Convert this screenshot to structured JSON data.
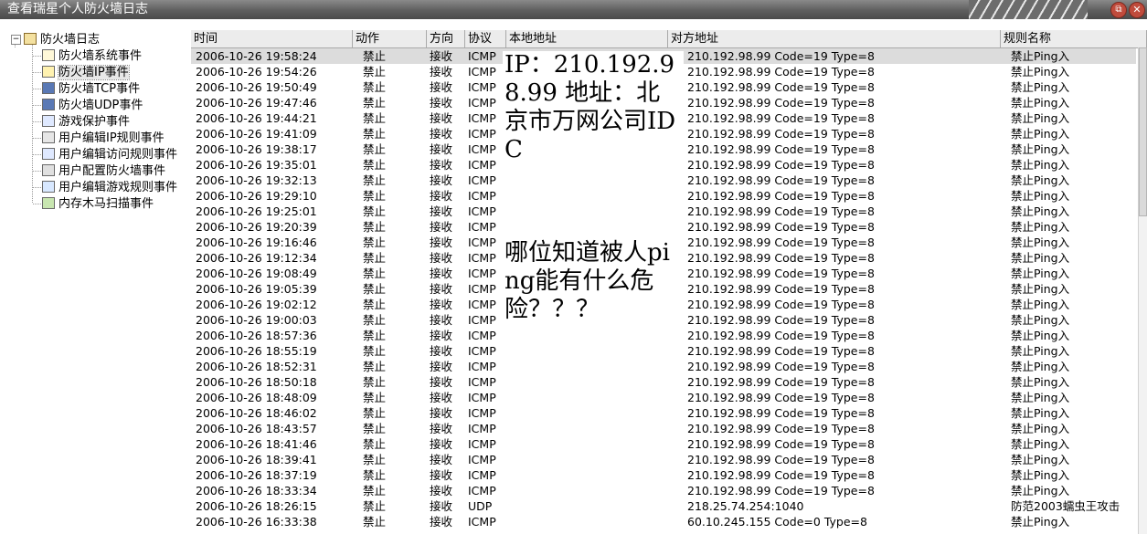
{
  "window": {
    "title": "查看瑞星个人防火墙日志"
  },
  "tree": {
    "root": "防火墙日志",
    "items": [
      {
        "label": "防火墙系统事件",
        "icon": "log-page-icon"
      },
      {
        "label": "防火墙IP事件",
        "icon": "ip-log-icon",
        "selected": true
      },
      {
        "label": "防火墙TCP事件",
        "icon": "computer-icon"
      },
      {
        "label": "防火墙UDP事件",
        "icon": "computer-icon"
      },
      {
        "label": "游戏保护事件",
        "icon": "exe-icon"
      },
      {
        "label": "用户编辑IP规则事件",
        "icon": "edit-rule-icon"
      },
      {
        "label": "用户编辑访问规则事件",
        "icon": "exe-icon"
      },
      {
        "label": "用户配置防火墙事件",
        "icon": "config-icon"
      },
      {
        "label": "用户编辑游戏规则事件",
        "icon": "game-rule-icon"
      },
      {
        "label": "内存木马扫描事件",
        "icon": "scan-chart-icon"
      }
    ]
  },
  "columns": [
    "时间",
    "动作",
    "方向",
    "协议",
    "本地地址",
    "对方地址",
    "规则名称"
  ],
  "rows": [
    [
      "2006-10-26 19:58:24",
      "禁止",
      "接收",
      "ICMP",
      "",
      "210.192.98.99 Code=19 Type=8",
      "禁止Ping入"
    ],
    [
      "2006-10-26 19:54:26",
      "禁止",
      "接收",
      "ICMP",
      "",
      "210.192.98.99 Code=19 Type=8",
      "禁止Ping入"
    ],
    [
      "2006-10-26 19:50:49",
      "禁止",
      "接收",
      "ICMP",
      "",
      "210.192.98.99 Code=19 Type=8",
      "禁止Ping入"
    ],
    [
      "2006-10-26 19:47:46",
      "禁止",
      "接收",
      "ICMP",
      "",
      "210.192.98.99 Code=19 Type=8",
      "禁止Ping入"
    ],
    [
      "2006-10-26 19:44:21",
      "禁止",
      "接收",
      "ICMP",
      "",
      "210.192.98.99 Code=19 Type=8",
      "禁止Ping入"
    ],
    [
      "2006-10-26 19:41:09",
      "禁止",
      "接收",
      "ICMP",
      "",
      "210.192.98.99 Code=19 Type=8",
      "禁止Ping入"
    ],
    [
      "2006-10-26 19:38:17",
      "禁止",
      "接收",
      "ICMP",
      "",
      "210.192.98.99 Code=19 Type=8",
      "禁止Ping入"
    ],
    [
      "2006-10-26 19:35:01",
      "禁止",
      "接收",
      "ICMP",
      "",
      "210.192.98.99 Code=19 Type=8",
      "禁止Ping入"
    ],
    [
      "2006-10-26 19:32:13",
      "禁止",
      "接收",
      "ICMP",
      "",
      "210.192.98.99 Code=19 Type=8",
      "禁止Ping入"
    ],
    [
      "2006-10-26 19:29:10",
      "禁止",
      "接收",
      "ICMP",
      "",
      "210.192.98.99 Code=19 Type=8",
      "禁止Ping入"
    ],
    [
      "2006-10-26 19:25:01",
      "禁止",
      "接收",
      "ICMP",
      "",
      "210.192.98.99 Code=19 Type=8",
      "禁止Ping入"
    ],
    [
      "2006-10-26 19:20:39",
      "禁止",
      "接收",
      "ICMP",
      "",
      "210.192.98.99 Code=19 Type=8",
      "禁止Ping入"
    ],
    [
      "2006-10-26 19:16:46",
      "禁止",
      "接收",
      "ICMP",
      "",
      "210.192.98.99 Code=19 Type=8",
      "禁止Ping入"
    ],
    [
      "2006-10-26 19:12:34",
      "禁止",
      "接收",
      "ICMP",
      "",
      "210.192.98.99 Code=19 Type=8",
      "禁止Ping入"
    ],
    [
      "2006-10-26 19:08:49",
      "禁止",
      "接收",
      "ICMP",
      "",
      "210.192.98.99 Code=19 Type=8",
      "禁止Ping入"
    ],
    [
      "2006-10-26 19:05:39",
      "禁止",
      "接收",
      "ICMP",
      "",
      "210.192.98.99 Code=19 Type=8",
      "禁止Ping入"
    ],
    [
      "2006-10-26 19:02:12",
      "禁止",
      "接收",
      "ICMP",
      "",
      "210.192.98.99 Code=19 Type=8",
      "禁止Ping入"
    ],
    [
      "2006-10-26 19:00:03",
      "禁止",
      "接收",
      "ICMP",
      "",
      "210.192.98.99 Code=19 Type=8",
      "禁止Ping入"
    ],
    [
      "2006-10-26 18:57:36",
      "禁止",
      "接收",
      "ICMP",
      "",
      "210.192.98.99 Code=19 Type=8",
      "禁止Ping入"
    ],
    [
      "2006-10-26 18:55:19",
      "禁止",
      "接收",
      "ICMP",
      "",
      "210.192.98.99 Code=19 Type=8",
      "禁止Ping入"
    ],
    [
      "2006-10-26 18:52:31",
      "禁止",
      "接收",
      "ICMP",
      "",
      "210.192.98.99 Code=19 Type=8",
      "禁止Ping入"
    ],
    [
      "2006-10-26 18:50:18",
      "禁止",
      "接收",
      "ICMP",
      "",
      "210.192.98.99 Code=19 Type=8",
      "禁止Ping入"
    ],
    [
      "2006-10-26 18:48:09",
      "禁止",
      "接收",
      "ICMP",
      "",
      "210.192.98.99 Code=19 Type=8",
      "禁止Ping入"
    ],
    [
      "2006-10-26 18:46:02",
      "禁止",
      "接收",
      "ICMP",
      "",
      "210.192.98.99 Code=19 Type=8",
      "禁止Ping入"
    ],
    [
      "2006-10-26 18:43:57",
      "禁止",
      "接收",
      "ICMP",
      "",
      "210.192.98.99 Code=19 Type=8",
      "禁止Ping入"
    ],
    [
      "2006-10-26 18:41:46",
      "禁止",
      "接收",
      "ICMP",
      "",
      "210.192.98.99 Code=19 Type=8",
      "禁止Ping入"
    ],
    [
      "2006-10-26 18:39:41",
      "禁止",
      "接收",
      "ICMP",
      "",
      "210.192.98.99 Code=19 Type=8",
      "禁止Ping入"
    ],
    [
      "2006-10-26 18:37:19",
      "禁止",
      "接收",
      "ICMP",
      "",
      "210.192.98.99 Code=19 Type=8",
      "禁止Ping入"
    ],
    [
      "2006-10-26 18:33:34",
      "禁止",
      "接收",
      "ICMP",
      "",
      "210.192.98.99 Code=19 Type=8",
      "禁止Ping入"
    ],
    [
      "2006-10-26 18:26:15",
      "禁止",
      "接收",
      "UDP",
      "",
      "218.25.74.254:1040",
      "防范2003蠕虫王攻击"
    ],
    [
      "2006-10-26 16:33:38",
      "禁止",
      "接收",
      "ICMP",
      "",
      "60.10.245.155 Code=0 Type=8",
      "禁止Ping入"
    ]
  ],
  "overlay": {
    "note1": "IP：210.192.98.99 地址：北京市万网公司IDC",
    "note2": "哪位知道被人ping能有什么危险？？？"
  },
  "colors": {
    "titlebar": "#5e5e5e",
    "header": "#ececec",
    "selection": "#dcdcdc"
  }
}
